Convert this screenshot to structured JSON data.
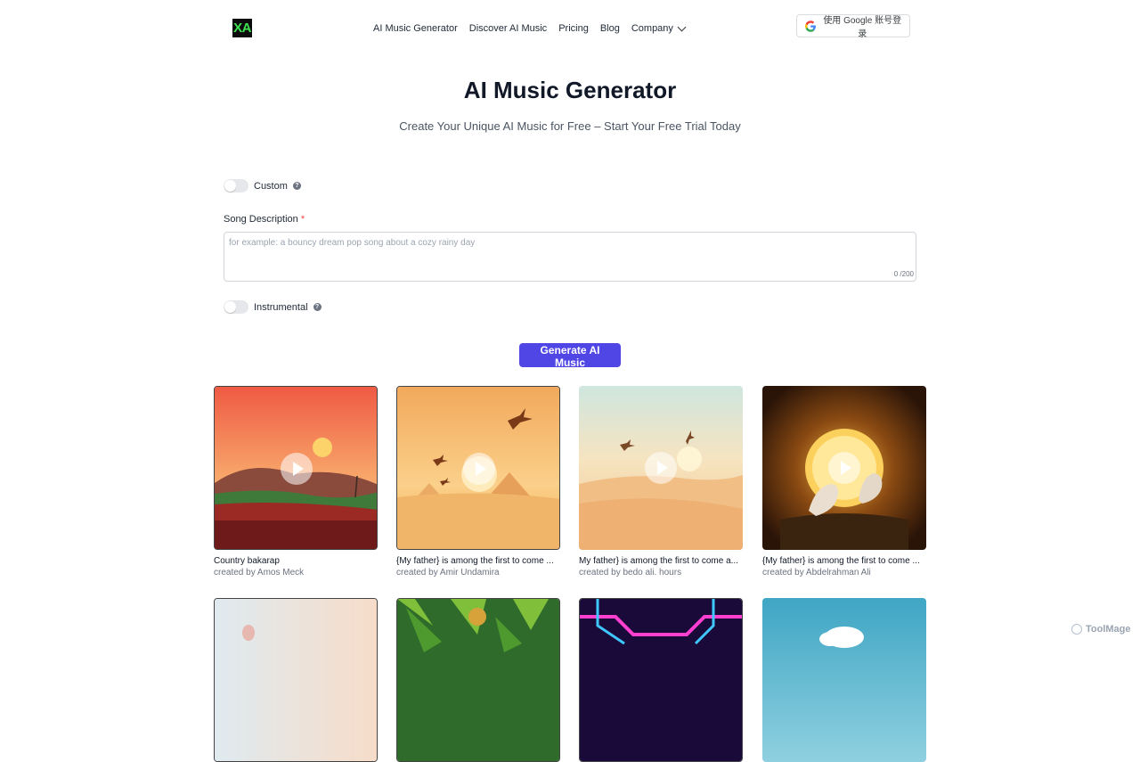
{
  "header": {
    "logo_text": "XA",
    "nav": [
      {
        "label": "AI Music Generator"
      },
      {
        "label": "Discover AI Music"
      },
      {
        "label": "Pricing"
      },
      {
        "label": "Blog"
      },
      {
        "label": "Company"
      }
    ],
    "google_login_label": "使用 Google 账号登录"
  },
  "hero": {
    "title": "AI Music Generator",
    "subtitle": "Create Your Unique AI Music for Free – Start Your Free Trial Today"
  },
  "form": {
    "custom_label": "Custom",
    "custom_on": false,
    "description_label": "Song Description",
    "required_mark": "*",
    "description_value": "",
    "description_placeholder": "for example: a bouncy dream pop song about a cozy rainy day",
    "char_counter": "0 /200",
    "instrumental_label": "Instrumental",
    "instrumental_on": false,
    "generate_label": "Generate AI Music",
    "help_glyph": "?"
  },
  "songs": [
    {
      "title": "Country bakarap",
      "author": "created by Amos Meck"
    },
    {
      "title": "{My father} is among the first to come ...",
      "author": "created by Amir Undamira"
    },
    {
      "title": "My father} is among the first to come a...",
      "author": "created by bedo ali. hours"
    },
    {
      "title": "{My father} is among the first to come ...",
      "author": "created by Abdelrahman Ali"
    }
  ],
  "watermark": "ToolMage",
  "colors": {
    "accent": "#4f46e5",
    "logo_bg": "#0b0b0b",
    "logo_text": "#3ee34f"
  }
}
